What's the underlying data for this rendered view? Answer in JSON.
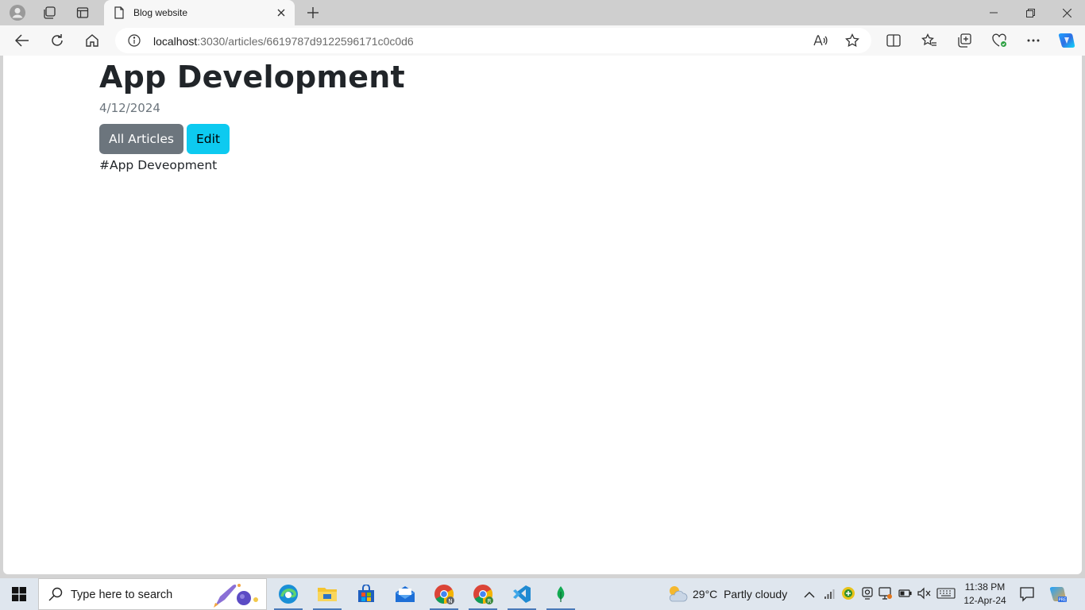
{
  "browser": {
    "tab_title": "Blog website",
    "url_host": "localhost",
    "url_rest": ":3030/articles/6619787d9122596171c0c0d6"
  },
  "article": {
    "title": "App Development",
    "date": "4/12/2024",
    "all_articles_label": "All Articles",
    "edit_label": "Edit",
    "body": "#App Deveopment"
  },
  "taskbar": {
    "search_placeholder": "Type here to search",
    "temperature": "29°C",
    "weather": "Partly cloudy",
    "time": "11:38 PM",
    "date": "12-Apr-24"
  },
  "colors": {
    "btn_secondary": "#6c757d",
    "btn_info": "#0dcaf0"
  }
}
